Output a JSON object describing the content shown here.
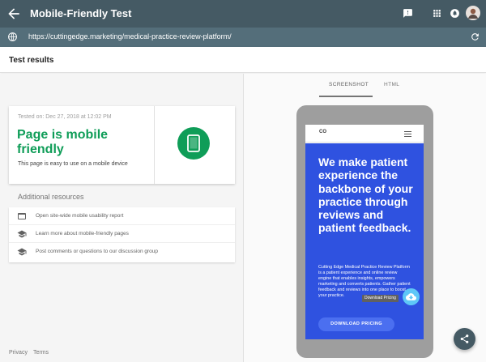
{
  "app": {
    "title": "Mobile-Friendly Test",
    "url": "https://cuttingedge.marketing/medical-practice-review-platform/"
  },
  "results": {
    "heading": "Test results",
    "tested_on": "Tested on: Dec 27, 2018 at 12:02 PM",
    "headline": "Page is mobile friendly",
    "subtext": "This page is easy to use on a mobile device"
  },
  "resources": {
    "heading": "Additional resources",
    "items": [
      {
        "label": "Open site-wide mobile usability report",
        "icon": "report-icon"
      },
      {
        "label": "Learn more about mobile-friendly pages",
        "icon": "school-icon"
      },
      {
        "label": "Post comments or questions to our discussion group",
        "icon": "school-icon"
      }
    ]
  },
  "footer": {
    "privacy": "Privacy",
    "terms": "Terms"
  },
  "tabs": {
    "screenshot": "SCREENSHOT",
    "html": "HTML"
  },
  "preview": {
    "logo": "CO",
    "hero_title": "We make patient experience the backbone of your practice through reviews and patient feedback.",
    "hero_body": "Cutting Edge Medical Practice Review Platform is a patient experience and online review engine that enables insights, empowers marketing and converts patients. Gather patient feedback and reviews into one place to boost your practice.",
    "tooltip": "Download Pricing",
    "button": "DOWNLOAD PRICING"
  },
  "colors": {
    "appbar": "#455a64",
    "urlbar": "#546e7a",
    "success_green": "#0f9d58",
    "hero_blue": "#2f52e0"
  }
}
